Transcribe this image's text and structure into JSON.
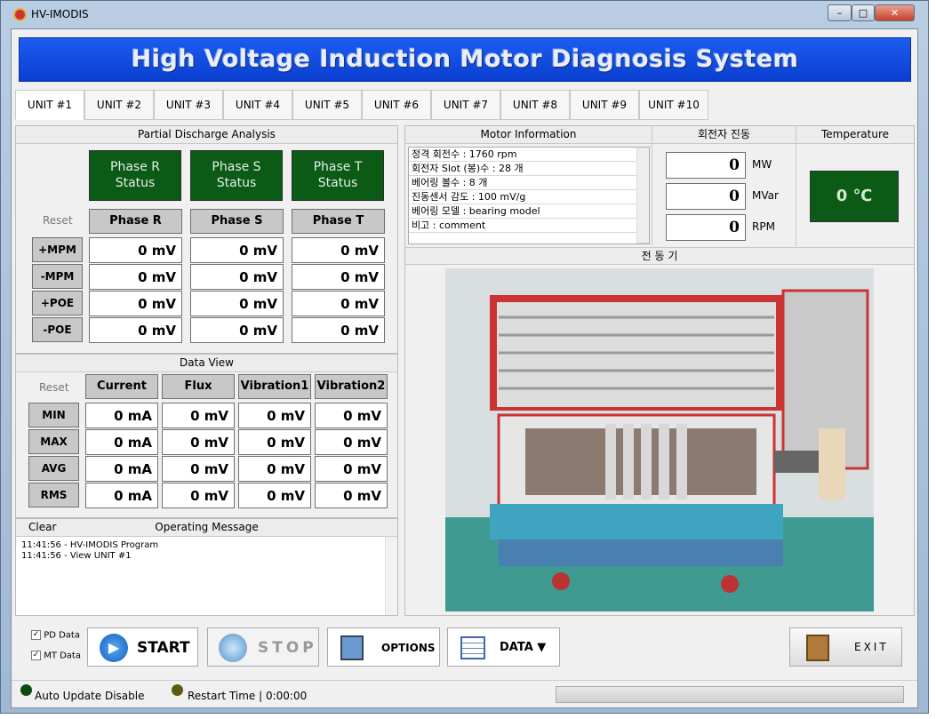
{
  "window": {
    "title": "HV-IMODIS",
    "minimize": "–",
    "maximize": "□",
    "close": "✕"
  },
  "banner": "High Voltage Induction Motor Diagnosis System",
  "tabs": [
    "UNIT #1",
    "UNIT #2",
    "UNIT #3",
    "UNIT #4",
    "UNIT #5",
    "UNIT #6",
    "UNIT #7",
    "UNIT #8",
    "UNIT #9",
    "UNIT #10"
  ],
  "pd": {
    "title": "Partial Discharge Analysis",
    "status": [
      "Phase R\nStatus",
      "Phase S\nStatus",
      "Phase T\nStatus"
    ],
    "reset": "Reset",
    "phases": [
      "Phase R",
      "Phase S",
      "Phase T"
    ],
    "rows": [
      {
        "label": "+MPM",
        "values": [
          "0 mV",
          "0 mV",
          "0 mV"
        ]
      },
      {
        "label": "-MPM",
        "values": [
          "0 mV",
          "0 mV",
          "0 mV"
        ]
      },
      {
        "label": "+POE",
        "values": [
          "0 mV",
          "0 mV",
          "0 mV"
        ]
      },
      {
        "label": "-POE",
        "values": [
          "0 mV",
          "0 mV",
          "0 mV"
        ]
      }
    ]
  },
  "dataview": {
    "title": "Data View",
    "reset": "Reset",
    "columns": [
      "Current",
      "Flux",
      "Vibration1",
      "Vibration2"
    ],
    "rows": [
      {
        "label": "MIN",
        "values": [
          "0 mA",
          "0 mV",
          "0 mV",
          "0 mV"
        ]
      },
      {
        "label": "MAX",
        "values": [
          "0 mA",
          "0 mV",
          "0 mV",
          "0 mV"
        ]
      },
      {
        "label": "AVG",
        "values": [
          "0 mA",
          "0 mV",
          "0 mV",
          "0 mV"
        ]
      },
      {
        "label": "RMS",
        "values": [
          "0 mA",
          "0 mV",
          "0 mV",
          "0 mV"
        ]
      }
    ]
  },
  "messages": {
    "clear": "Clear",
    "title": "Operating Message",
    "lines": [
      "11:41:56 - HV-IMODIS Program",
      "11:41:56 - View UNIT #1"
    ]
  },
  "motor_info": {
    "title": "Motor Information",
    "items": [
      "정격 회전수 : 1760 rpm",
      "회전자 Slot (봉)수 : 28 개",
      "베어링 볼수 : 8 개",
      "진동센서 감도 : 100 mV/g",
      "베어링 모델 : bearing model",
      "비고 : comment"
    ]
  },
  "rotor": {
    "title": "회전자 진동",
    "readings": [
      {
        "value": "0",
        "unit": "MW"
      },
      {
        "value": "0",
        "unit": "MVar"
      },
      {
        "value": "0",
        "unit": "RPM"
      }
    ]
  },
  "temperature": {
    "title": "Temperature",
    "value": "0 ℃"
  },
  "image_title": "전 동 기",
  "toolbar": {
    "pd_data": "PD Data",
    "mt_data": "MT Data",
    "pd_checked": true,
    "mt_checked": true,
    "start": "START",
    "stop": "STOP",
    "options": "OPTIONS",
    "data": "DATA ▼",
    "exit": "EXIT"
  },
  "statusbar": {
    "auto_update": "Auto Update Disable",
    "restart": "Restart Time | 0:00:00",
    "progress": 0
  },
  "colors": {
    "banner": "#0a3fd0",
    "status_green": "#0b5a16"
  }
}
